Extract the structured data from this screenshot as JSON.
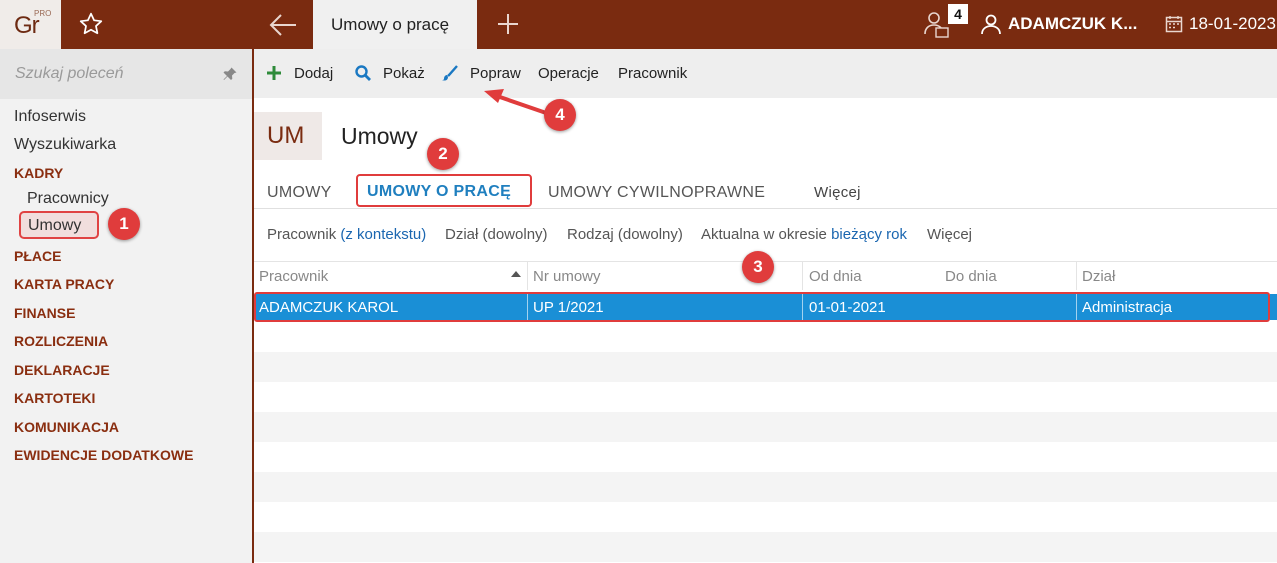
{
  "topbar": {
    "logo_text": "Gr",
    "logo_sup": "PRO",
    "active_tab": "Umowy o pracę",
    "notif_count": "4",
    "user_name": "ADAMCZUK K...",
    "date": "18-01-2023"
  },
  "sidebar": {
    "search_placeholder": "Szukaj poleceń",
    "items": [
      {
        "label": "Infoserwis"
      },
      {
        "label": "Wyszukiwarka"
      }
    ],
    "kadry": "KADRY",
    "kadry_sub": [
      "Pracownicy",
      "Umowy"
    ],
    "sections": [
      "PŁACE",
      "KARTA PRACY",
      "FINANSE",
      "ROZLICZENIA",
      "DEKLARACJE",
      "KARTOTEKI",
      "KOMUNIKACJA",
      "EWIDENCJE DODATKOWE"
    ]
  },
  "toolbar": {
    "add": "Dodaj",
    "show": "Pokaż",
    "edit": "Popraw",
    "operations": "Operacje",
    "employee": "Pracownik"
  },
  "page": {
    "abbr": "UM",
    "title": "Umowy"
  },
  "tabs": {
    "t1": "UMOWY",
    "t2": "UMOWY O PRACĘ",
    "t3": "UMOWY CYWILNOPRAWNE",
    "more": "Więcej"
  },
  "filters": {
    "f1_label": "Pracownik",
    "f1_value": "(z kontekstu)",
    "f2": "Dział (dowolny)",
    "f3": "Rodzaj (dowolny)",
    "f4_label": "Aktualna w okresie",
    "f4_value": "bieżący rok",
    "more": "Więcej"
  },
  "grid": {
    "headers": [
      "Pracownik",
      "Nr umowy",
      "Od dnia",
      "Do dnia",
      "Dział"
    ],
    "rows": [
      {
        "employee": "ADAMCZUK KAROL",
        "number": "UP 1/2021",
        "from": "01-01-2021",
        "to": "",
        "department": "Administracja"
      }
    ]
  },
  "annotations": [
    "1",
    "2",
    "3",
    "4"
  ],
  "colors": {
    "brand": "#7a2b10",
    "accent": "#1f7fbf",
    "selection": "#1a8fd6",
    "annotation": "#e03c3c"
  }
}
